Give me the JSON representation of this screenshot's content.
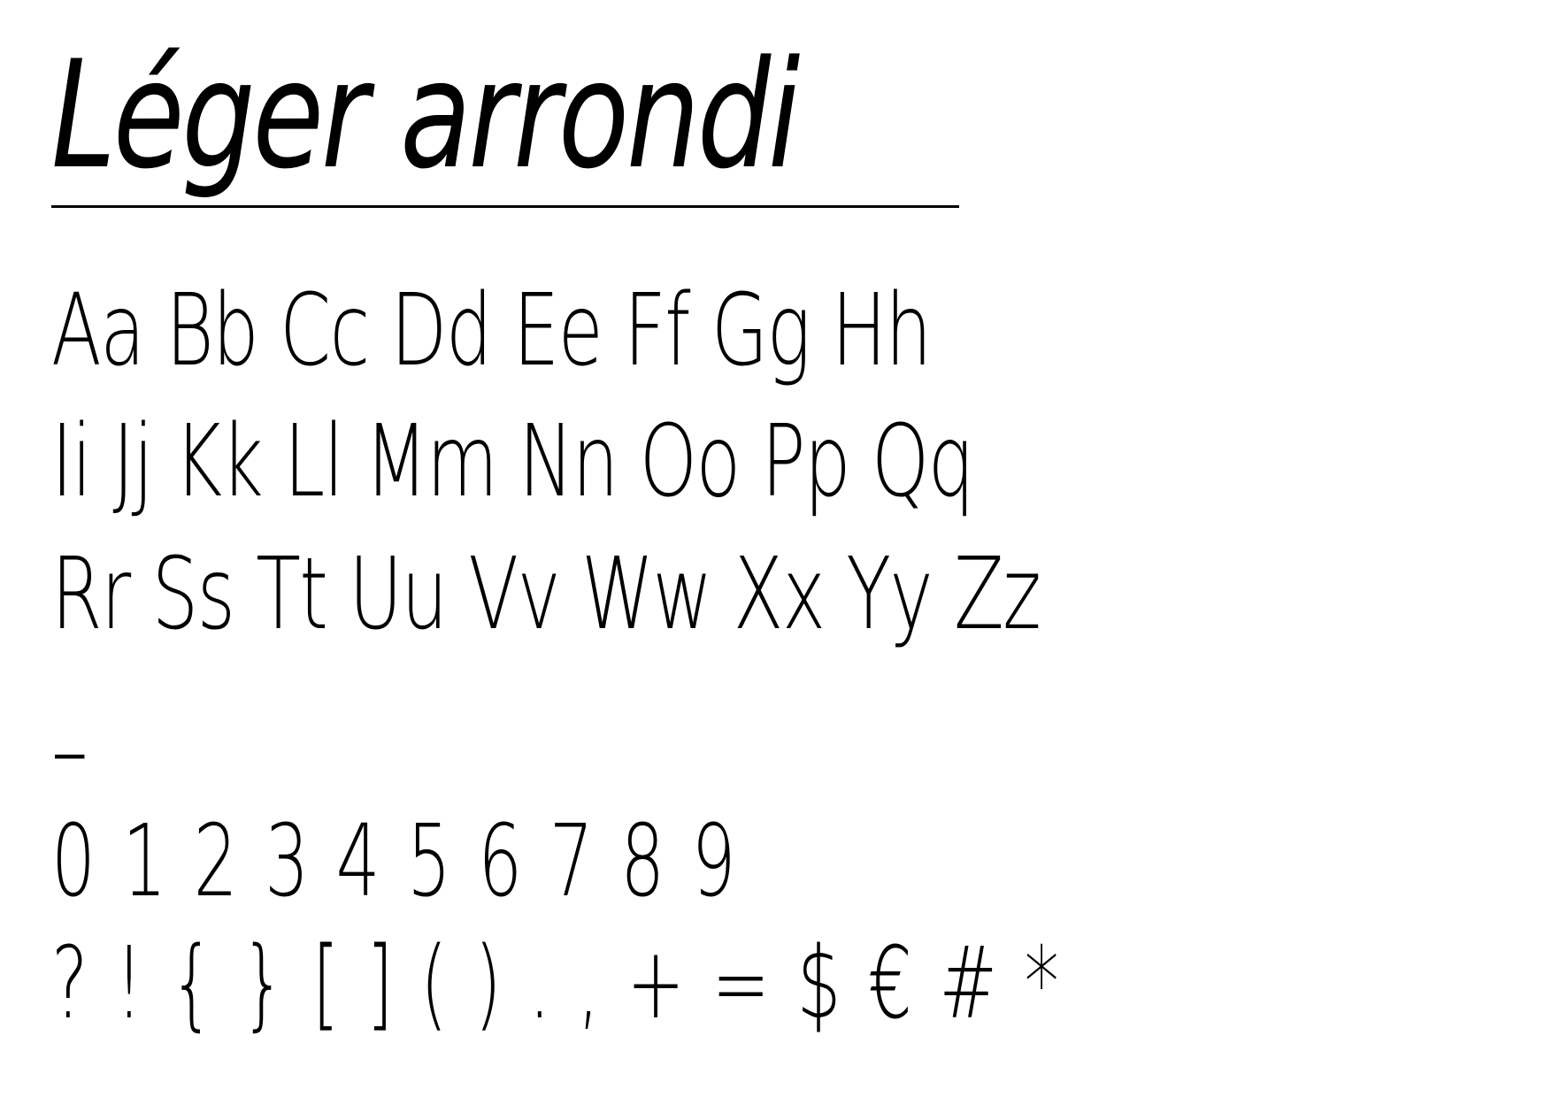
{
  "specimen": {
    "title": "Léger arrondi",
    "rows": [
      "Aa Bb Cc Dd Ee Ff Gg Hh",
      "Ii Jj Kk Ll Mm Nn Oo Pp Qq",
      "Rr Ss Tt Uu Vv Ww Xx Yy Zz"
    ],
    "dash": "–",
    "digits": "0 1 2 3 4 5 6 7 8 9",
    "symbols": "? ! { } [ ] ( ) . , + = $ € # *"
  }
}
